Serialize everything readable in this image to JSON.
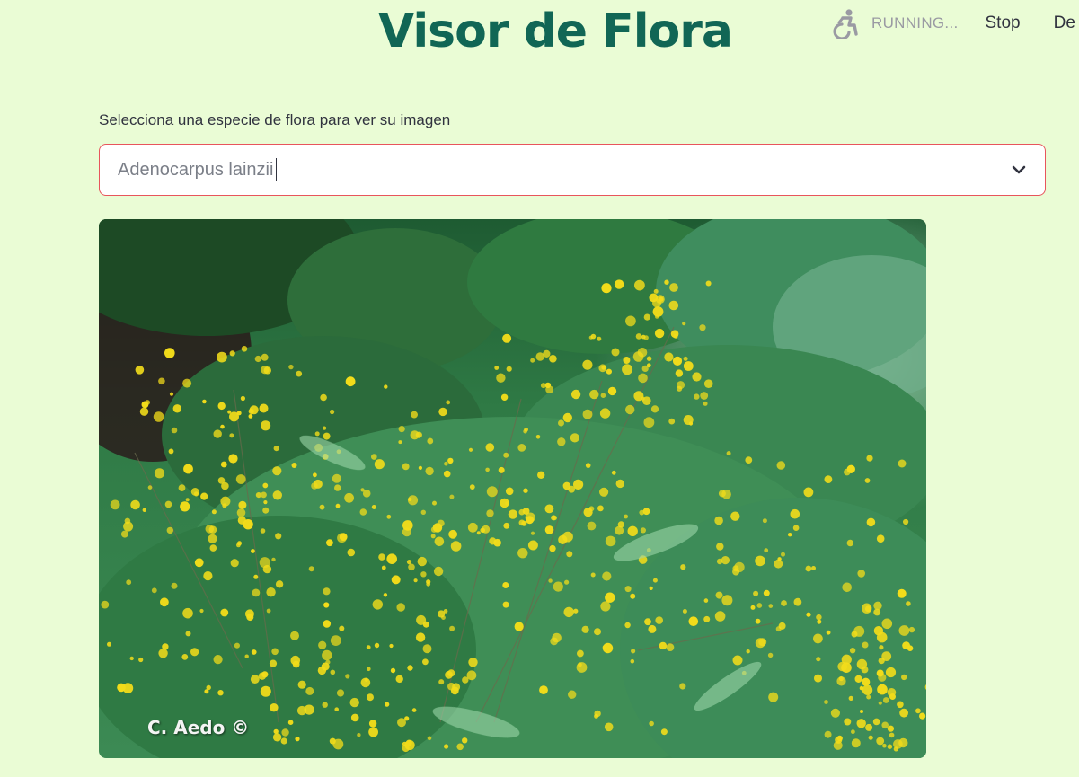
{
  "header": {
    "title": "Visor de Flora"
  },
  "toolbar": {
    "status_icon": "running-man-icon",
    "status_text": "RUNNING...",
    "stop_label": "Stop",
    "deploy_label": "De"
  },
  "species_select": {
    "label": "Selecciona una especie de flora para ver su imagen",
    "value": "Adenocarpus lainzii",
    "icon": "chevron-down-icon"
  },
  "image": {
    "watermark": "C. Aedo ©"
  },
  "colors": {
    "background": "#eafcd5",
    "title": "#116655",
    "select_border_focus": "#e8555c",
    "flower_yellow": "#f2dc1a"
  }
}
